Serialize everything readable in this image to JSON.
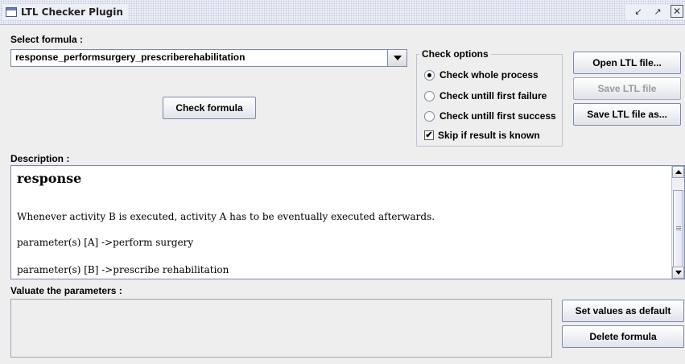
{
  "window": {
    "title": "LTL Checker Plugin",
    "icon": "window-icon"
  },
  "select_formula": {
    "label": "Select formula :",
    "value": "response_performsurgery_prescriberehabilitation"
  },
  "check_formula_button": {
    "label": "Check formula"
  },
  "check_options": {
    "title": "Check options",
    "options": [
      {
        "label": "Check whole process",
        "selected": true
      },
      {
        "label": "Check untill first failure",
        "selected": false
      },
      {
        "label": "Check untill first success",
        "selected": false
      }
    ],
    "skip": {
      "label": "Skip if result is known",
      "checked": true
    }
  },
  "file_buttons": {
    "open": "Open LTL file...",
    "save": "Save LTL file",
    "save_as": "Save LTL file as..."
  },
  "description": {
    "label": "Description :",
    "heading": "response",
    "text": "Whenever activity B is executed, activity A has to be eventually executed afterwards.",
    "param_a": "parameter(s) [A] ->perform surgery",
    "param_b": "parameter(s) [B] ->prescribe rehabilitation"
  },
  "parameters": {
    "label": "Valuate the parameters :",
    "set_default_button": "Set values as default",
    "delete_button": "Delete formula"
  }
}
